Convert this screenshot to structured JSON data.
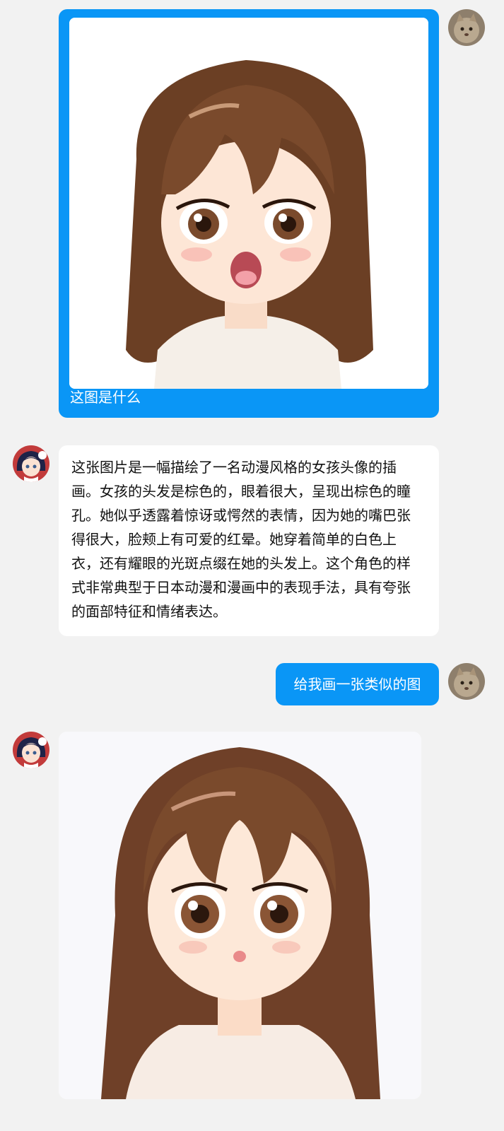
{
  "messages": [
    {
      "role": "user",
      "type": "image_with_caption",
      "caption": "这图是什么",
      "avatar_icon": "cat-avatar-icon",
      "image_icon": "anime-girl-surprised-illustration"
    },
    {
      "role": "assistant",
      "type": "text",
      "avatar_icon": "anime-avatar-icon",
      "text": "这张图片是一幅描绘了一名动漫风格的女孩头像的插画。女孩的头发是棕色的，眼着很大，呈现出棕色的瞳孔。她似乎透露着惊讶或愕然的表情，因为她的嘴巴张得很大，脸颊上有可爱的红晕。她穿着简单的白色上衣，还有耀眼的光斑点缀在她的头发上。这个角色的样式非常典型于日本动漫和漫画中的表现手法，具有夸张的面部特征和情绪表达。"
    },
    {
      "role": "user",
      "type": "text",
      "avatar_icon": "cat-avatar-icon",
      "text": "给我画一张类似的图"
    },
    {
      "role": "assistant",
      "type": "image",
      "avatar_icon": "anime-avatar-icon",
      "image_icon": "anime-girl-generated-illustration"
    }
  ],
  "colors": {
    "background": "#f2f2f2",
    "user_bubble": "#0a96f6",
    "assistant_bubble": "#ffffff",
    "hair": "#7a4a2c",
    "skin": "#fde6d6"
  }
}
